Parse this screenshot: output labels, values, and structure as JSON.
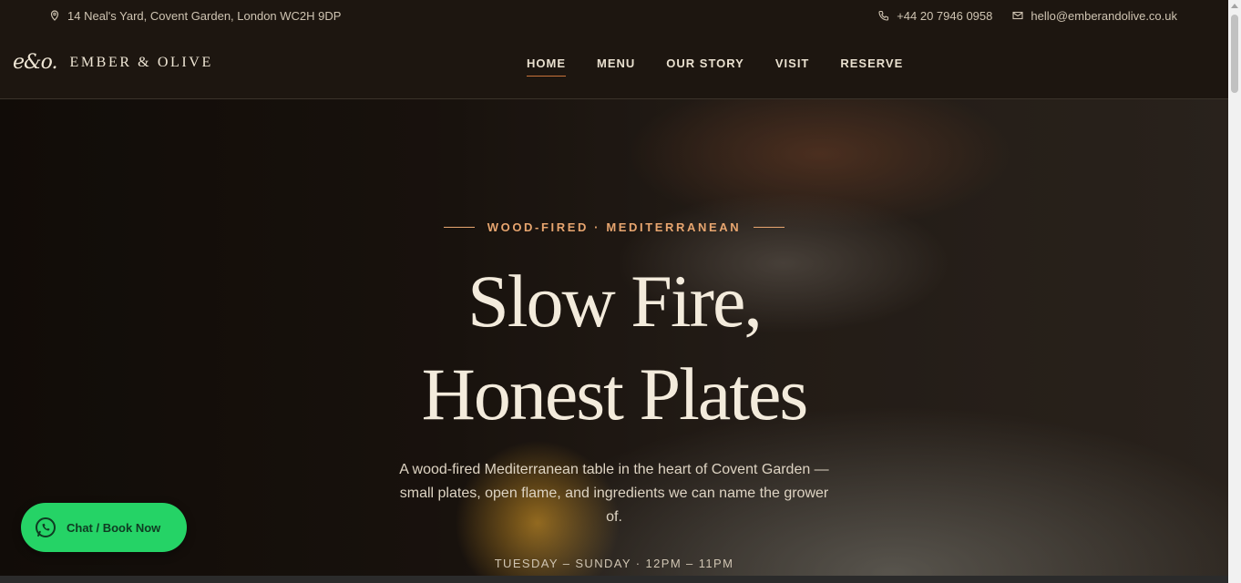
{
  "topbar": {
    "address": "14 Neal's Yard, Covent Garden, London WC2H 9DP",
    "phone": "+44 20 7946 0958",
    "email": "hello@emberandolive.co.uk"
  },
  "brand": {
    "mark": "e&o.",
    "name": "EMBER & OLIVE"
  },
  "nav": {
    "items": [
      {
        "label": "HOME",
        "active": true
      },
      {
        "label": "MENU"
      },
      {
        "label": "OUR STORY"
      },
      {
        "label": "VISIT"
      },
      {
        "label": "RESERVE"
      }
    ]
  },
  "hero": {
    "eyebrow": "WOOD-FIRED · MEDITERRANEAN",
    "title_line1": "Slow Fire,",
    "title_line2": "Honest Plates",
    "lead": "A wood-fired Mediterranean table in the heart of Covent Garden — small plates, open flame, and ingredients we can name the grower of.",
    "hours": "TUESDAY – SUNDAY · 12PM – 11PM"
  },
  "whatsapp": {
    "label": "Chat / Book Now",
    "color": "#25d366"
  },
  "colors": {
    "accent": "#e7a56f",
    "background": "#1d1610"
  }
}
